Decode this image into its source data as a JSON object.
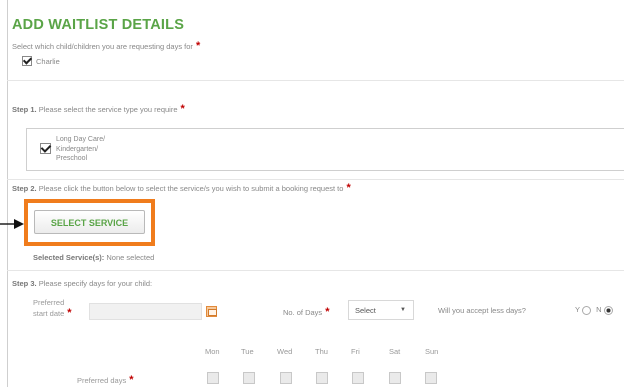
{
  "form": {
    "title": "ADD WAITLIST DETAILS",
    "instruction": "Select which child/children you are requesting days for",
    "required_marker": "*",
    "children": [
      {
        "name": "Charlie",
        "checked": true
      }
    ],
    "step1": {
      "label": "Step 1.",
      "text": "Please select the service type you require",
      "services": [
        {
          "label_lines": [
            "Long Day Care/",
            "Kindergarten/",
            "Preschool"
          ],
          "checked": true
        }
      ]
    },
    "step2": {
      "label": "Step 2.",
      "text": "Please click the button below to select the service/s you wish to submit a booking request to",
      "button_label": "SELECT SERVICE",
      "selected_label": "Selected Service(s):",
      "selected_value": "None selected"
    },
    "step3": {
      "label": "Step 3.",
      "text": "Please specify days for your child:",
      "preferred_start_line1": "Preferred",
      "preferred_start_line2": "start date",
      "start_date_value": "",
      "no_of_days_label": "No. of Days",
      "no_of_days_value": "Select",
      "accept_less_label": "Will you accept less days?",
      "yes_label": "Y",
      "no_label": "N",
      "accept_less_selected": "N",
      "weekdays": [
        "Mon",
        "Tue",
        "Wed",
        "Thu",
        "Fri",
        "Sat",
        "Sun"
      ],
      "preferred_days_label": "Preferred days"
    }
  },
  "colors": {
    "title_green": "#5aa447",
    "highlight_orange": "#f07c1c",
    "required_red": "#c00000"
  },
  "icons": {
    "arrow": "arrow-right-icon",
    "calendar": "calendar-icon",
    "caret": "caret-down-icon"
  }
}
